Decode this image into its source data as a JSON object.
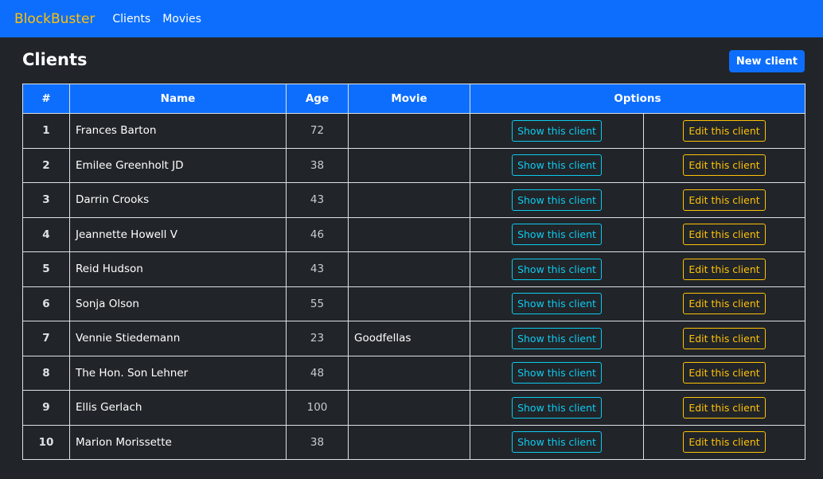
{
  "navbar": {
    "brand": "BlockBuster",
    "links": [
      "Clients",
      "Movies"
    ]
  },
  "page": {
    "title": "Clients",
    "new_button": "New client"
  },
  "table": {
    "headers": [
      "#",
      "Name",
      "Age",
      "Movie",
      "Options"
    ],
    "show_label": "Show this client",
    "edit_label": "Edit this client",
    "rows": [
      {
        "num": "1",
        "name": "Frances Barton",
        "age": "72",
        "movie": ""
      },
      {
        "num": "2",
        "name": "Emilee Greenholt JD",
        "age": "38",
        "movie": ""
      },
      {
        "num": "3",
        "name": "Darrin Crooks",
        "age": "43",
        "movie": ""
      },
      {
        "num": "4",
        "name": "Jeannette Howell V",
        "age": "46",
        "movie": ""
      },
      {
        "num": "5",
        "name": "Reid Hudson",
        "age": "43",
        "movie": ""
      },
      {
        "num": "6",
        "name": "Sonja Olson",
        "age": "55",
        "movie": ""
      },
      {
        "num": "7",
        "name": "Vennie Stiedemann",
        "age": "23",
        "movie": "Goodfellas"
      },
      {
        "num": "8",
        "name": "The Hon. Son Lehner",
        "age": "48",
        "movie": ""
      },
      {
        "num": "9",
        "name": "Ellis Gerlach",
        "age": "100",
        "movie": ""
      },
      {
        "num": "10",
        "name": "Marion Morissette",
        "age": "38",
        "movie": ""
      }
    ]
  },
  "colors": {
    "primary": "#0d6efd",
    "background": "#212529",
    "brand": "#ffc107",
    "info": "#0dcaf0",
    "warning": "#ffc107"
  }
}
